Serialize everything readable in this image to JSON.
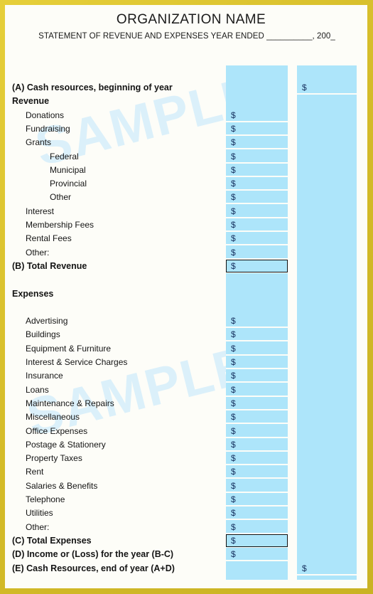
{
  "document": {
    "title": "ORGANIZATION NAME",
    "subtitle": "STATEMENT OF REVENUE AND EXPENSES YEAR ENDED __________, 200_",
    "watermark": "SAMPLE",
    "currency_symbol": "$",
    "frame_color": "#d4bb28",
    "column_fill_color": "#ade5fa",
    "paper_color": "#fdfdf8",
    "text_color": "#141414",
    "dollar_color": "#16305e"
  },
  "columns": [
    {
      "id": "column-1",
      "name": "amount-column"
    },
    {
      "id": "column-2",
      "name": "total-column"
    }
  ],
  "rows": [
    {
      "label": "(A) Cash resources, beginning of year",
      "bold": true,
      "indent": 0,
      "dollar_col1": false,
      "dollar_col2": true,
      "boxed": false
    },
    {
      "label": "Revenue",
      "bold": true,
      "indent": 0,
      "dollar_col1": false,
      "dollar_col2": false,
      "boxed": false
    },
    {
      "label": "Donations",
      "bold": false,
      "indent": 1,
      "dollar_col1": true,
      "dollar_col2": false,
      "boxed": false
    },
    {
      "label": "Fundraising",
      "bold": false,
      "indent": 1,
      "dollar_col1": true,
      "dollar_col2": false,
      "boxed": false
    },
    {
      "label": "Grants",
      "bold": false,
      "indent": 1,
      "dollar_col1": true,
      "dollar_col2": false,
      "boxed": false
    },
    {
      "label": "Federal",
      "bold": false,
      "indent": 2,
      "dollar_col1": true,
      "dollar_col2": false,
      "boxed": false
    },
    {
      "label": "Municipal",
      "bold": false,
      "indent": 2,
      "dollar_col1": true,
      "dollar_col2": false,
      "boxed": false
    },
    {
      "label": "Provincial",
      "bold": false,
      "indent": 2,
      "dollar_col1": true,
      "dollar_col2": false,
      "boxed": false
    },
    {
      "label": "Other",
      "bold": false,
      "indent": 2,
      "dollar_col1": true,
      "dollar_col2": false,
      "boxed": false
    },
    {
      "label": "Interest",
      "bold": false,
      "indent": 1,
      "dollar_col1": true,
      "dollar_col2": false,
      "boxed": false
    },
    {
      "label": "Membership Fees",
      "bold": false,
      "indent": 1,
      "dollar_col1": true,
      "dollar_col2": false,
      "boxed": false
    },
    {
      "label": "Rental Fees",
      "bold": false,
      "indent": 1,
      "dollar_col1": true,
      "dollar_col2": false,
      "boxed": false
    },
    {
      "label": "Other:",
      "bold": false,
      "indent": 1,
      "dollar_col1": true,
      "dollar_col2": false,
      "boxed": false
    },
    {
      "label": "(B) Total Revenue",
      "bold": true,
      "indent": 0,
      "dollar_col1": true,
      "dollar_col2": false,
      "boxed": true
    },
    {
      "label": "",
      "bold": false,
      "indent": 0,
      "dollar_col1": false,
      "dollar_col2": false,
      "boxed": false
    },
    {
      "label": "Expenses",
      "bold": true,
      "indent": 0,
      "dollar_col1": false,
      "dollar_col2": false,
      "boxed": false
    },
    {
      "label": "",
      "bold": false,
      "indent": 0,
      "dollar_col1": false,
      "dollar_col2": false,
      "boxed": false
    },
    {
      "label": "Advertising",
      "bold": false,
      "indent": 1,
      "dollar_col1": true,
      "dollar_col2": false,
      "boxed": false
    },
    {
      "label": "Buildings",
      "bold": false,
      "indent": 1,
      "dollar_col1": true,
      "dollar_col2": false,
      "boxed": false
    },
    {
      "label": "Equipment & Furniture",
      "bold": false,
      "indent": 1,
      "dollar_col1": true,
      "dollar_col2": false,
      "boxed": false
    },
    {
      "label": "Interest & Service Charges",
      "bold": false,
      "indent": 1,
      "dollar_col1": true,
      "dollar_col2": false,
      "boxed": false
    },
    {
      "label": "Insurance",
      "bold": false,
      "indent": 1,
      "dollar_col1": true,
      "dollar_col2": false,
      "boxed": false
    },
    {
      "label": "Loans",
      "bold": false,
      "indent": 1,
      "dollar_col1": true,
      "dollar_col2": false,
      "boxed": false
    },
    {
      "label": "Maintenance & Repairs",
      "bold": false,
      "indent": 1,
      "dollar_col1": true,
      "dollar_col2": false,
      "boxed": false
    },
    {
      "label": "Miscellaneous",
      "bold": false,
      "indent": 1,
      "dollar_col1": true,
      "dollar_col2": false,
      "boxed": false
    },
    {
      "label": "Office Expenses",
      "bold": false,
      "indent": 1,
      "dollar_col1": true,
      "dollar_col2": false,
      "boxed": false
    },
    {
      "label": "Postage & Stationery",
      "bold": false,
      "indent": 1,
      "dollar_col1": true,
      "dollar_col2": false,
      "boxed": false
    },
    {
      "label": "Property Taxes",
      "bold": false,
      "indent": 1,
      "dollar_col1": true,
      "dollar_col2": false,
      "boxed": false
    },
    {
      "label": "Rent",
      "bold": false,
      "indent": 1,
      "dollar_col1": true,
      "dollar_col2": false,
      "boxed": false
    },
    {
      "label": "Salaries & Benefits",
      "bold": false,
      "indent": 1,
      "dollar_col1": true,
      "dollar_col2": false,
      "boxed": false
    },
    {
      "label": "Telephone",
      "bold": false,
      "indent": 1,
      "dollar_col1": true,
      "dollar_col2": false,
      "boxed": false
    },
    {
      "label": "Utilities",
      "bold": false,
      "indent": 1,
      "dollar_col1": true,
      "dollar_col2": false,
      "boxed": false
    },
    {
      "label": "Other:",
      "bold": false,
      "indent": 1,
      "dollar_col1": true,
      "dollar_col2": false,
      "boxed": false
    },
    {
      "label": "(C) Total Expenses",
      "bold": true,
      "indent": 0,
      "dollar_col1": true,
      "dollar_col2": false,
      "boxed": true
    },
    {
      "label": "(D) Income or (Loss) for the year (B-C)",
      "bold": true,
      "indent": 0,
      "dollar_col1": true,
      "dollar_col2": false,
      "boxed": false
    },
    {
      "label": "(E) Cash Resources, end of year (A+D)",
      "bold": true,
      "indent": 0,
      "dollar_col1": false,
      "dollar_col2": true,
      "boxed": false
    }
  ]
}
